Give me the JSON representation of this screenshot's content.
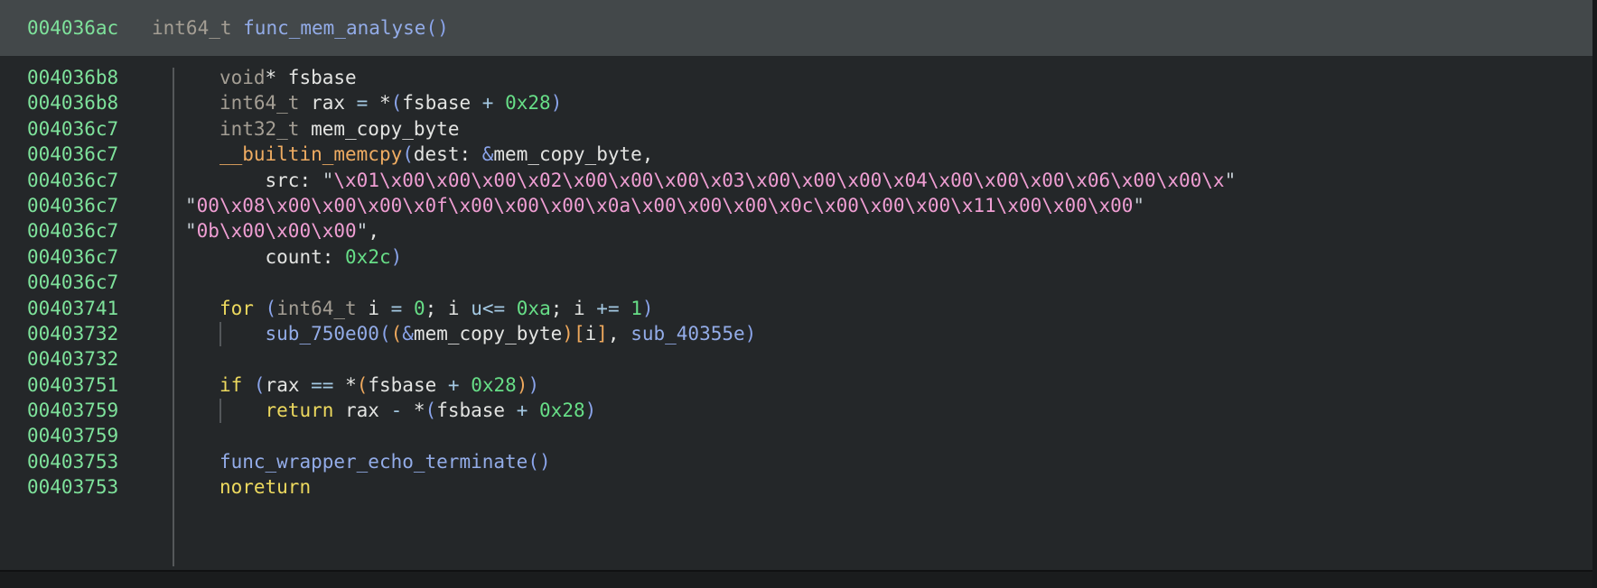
{
  "header": {
    "address": "004036ac",
    "return_type": "int64_t ",
    "function_name": "func_mem_analyse",
    "parens": "()"
  },
  "listing": {
    "lines": [
      {
        "address": "004036b8",
        "indent": 3,
        "guide": false,
        "segments": [
          {
            "c": "type",
            "t": "void"
          },
          {
            "c": "plain",
            "t": "* fsbase"
          }
        ]
      },
      {
        "address": "004036b8",
        "indent": 3,
        "guide": false,
        "segments": [
          {
            "c": "type",
            "t": "int64_t"
          },
          {
            "c": "plain",
            "t": " rax "
          },
          {
            "c": "op",
            "t": "="
          },
          {
            "c": "plain",
            "t": " *"
          },
          {
            "c": "p1",
            "t": "("
          },
          {
            "c": "plain",
            "t": "fsbase "
          },
          {
            "c": "op",
            "t": "+"
          },
          {
            "c": "plain",
            "t": " "
          },
          {
            "c": "num",
            "t": "0x28"
          },
          {
            "c": "p1",
            "t": ")"
          }
        ]
      },
      {
        "address": "004036c7",
        "indent": 3,
        "guide": false,
        "segments": [
          {
            "c": "type",
            "t": "int32_t"
          },
          {
            "c": "plain",
            "t": " mem_copy_byte"
          }
        ]
      },
      {
        "address": "004036c7",
        "indent": 3,
        "guide": false,
        "segments": [
          {
            "c": "builtin",
            "t": "__builtin_memcpy"
          },
          {
            "c": "p1",
            "t": "("
          },
          {
            "c": "plain",
            "t": "dest: "
          },
          {
            "c": "p1",
            "t": "&"
          },
          {
            "c": "plain",
            "t": "mem_copy_byte,"
          }
        ]
      },
      {
        "address": "004036c7",
        "indent": 7,
        "guide": false,
        "segments": [
          {
            "c": "plain",
            "t": "src: "
          },
          {
            "c": "q",
            "t": "\""
          },
          {
            "c": "str",
            "t": "\\x01\\x00\\x00\\x00\\x02\\x00\\x00\\x00\\x03\\x00\\x00\\x00\\x04\\x00\\x00\\x00\\x06\\x00\\x00\\x"
          },
          {
            "c": "q",
            "t": "\""
          }
        ]
      },
      {
        "address": "004036c7",
        "indent": 0,
        "guide": false,
        "segments": [
          {
            "c": "q",
            "t": "\""
          },
          {
            "c": "str",
            "t": "00\\x08\\x00\\x00\\x00\\x0f\\x00\\x00\\x00\\x0a\\x00\\x00\\x00\\x0c\\x00\\x00\\x00\\x11\\x00\\x00\\x00"
          },
          {
            "c": "q",
            "t": "\""
          }
        ]
      },
      {
        "address": "004036c7",
        "indent": 0,
        "guide": false,
        "segments": [
          {
            "c": "q",
            "t": "\""
          },
          {
            "c": "str",
            "t": "0b\\x00\\x00\\x00"
          },
          {
            "c": "q",
            "t": "\""
          },
          {
            "c": "plain",
            "t": ","
          }
        ]
      },
      {
        "address": "004036c7",
        "indent": 7,
        "guide": false,
        "segments": [
          {
            "c": "plain",
            "t": "count: "
          },
          {
            "c": "num",
            "t": "0x2c"
          },
          {
            "c": "p1",
            "t": ")"
          }
        ]
      },
      {
        "address": "004036c7",
        "indent": 0,
        "guide": false,
        "segments": []
      },
      {
        "address": "00403741",
        "indent": 3,
        "guide": false,
        "segments": [
          {
            "c": "kw",
            "t": "for"
          },
          {
            "c": "plain",
            "t": " "
          },
          {
            "c": "p1",
            "t": "("
          },
          {
            "c": "type",
            "t": "int64_t"
          },
          {
            "c": "plain",
            "t": " i "
          },
          {
            "c": "op",
            "t": "="
          },
          {
            "c": "plain",
            "t": " "
          },
          {
            "c": "num",
            "t": "0"
          },
          {
            "c": "plain",
            "t": "; i "
          },
          {
            "c": "op",
            "t": "u<="
          },
          {
            "c": "plain",
            "t": " "
          },
          {
            "c": "num",
            "t": "0xa"
          },
          {
            "c": "plain",
            "t": "; i "
          },
          {
            "c": "op",
            "t": "+="
          },
          {
            "c": "plain",
            "t": " "
          },
          {
            "c": "num",
            "t": "1"
          },
          {
            "c": "p1",
            "t": ")"
          }
        ]
      },
      {
        "address": "00403732",
        "indent": 7,
        "guide": true,
        "segments": [
          {
            "c": "fn",
            "t": "sub_750e00"
          },
          {
            "c": "p1",
            "t": "("
          },
          {
            "c": "p2",
            "t": "("
          },
          {
            "c": "p1",
            "t": "&"
          },
          {
            "c": "plain",
            "t": "mem_copy_byte"
          },
          {
            "c": "p2",
            "t": ")"
          },
          {
            "c": "p2",
            "t": "["
          },
          {
            "c": "plain",
            "t": "i"
          },
          {
            "c": "p2",
            "t": "]"
          },
          {
            "c": "plain",
            "t": ", "
          },
          {
            "c": "fn",
            "t": "sub_40355e"
          },
          {
            "c": "p1",
            "t": ")"
          }
        ]
      },
      {
        "address": "00403732",
        "indent": 0,
        "guide": false,
        "segments": []
      },
      {
        "address": "00403751",
        "indent": 3,
        "guide": false,
        "segments": [
          {
            "c": "kw",
            "t": "if"
          },
          {
            "c": "plain",
            "t": " "
          },
          {
            "c": "p1",
            "t": "("
          },
          {
            "c": "plain",
            "t": "rax "
          },
          {
            "c": "op",
            "t": "=="
          },
          {
            "c": "plain",
            "t": " *"
          },
          {
            "c": "p2",
            "t": "("
          },
          {
            "c": "plain",
            "t": "fsbase "
          },
          {
            "c": "op",
            "t": "+"
          },
          {
            "c": "plain",
            "t": " "
          },
          {
            "c": "num",
            "t": "0x28"
          },
          {
            "c": "p2",
            "t": ")"
          },
          {
            "c": "p1",
            "t": ")"
          }
        ]
      },
      {
        "address": "00403759",
        "indent": 7,
        "guide": true,
        "segments": [
          {
            "c": "kw",
            "t": "return"
          },
          {
            "c": "plain",
            "t": " rax "
          },
          {
            "c": "op",
            "t": "-"
          },
          {
            "c": "plain",
            "t": " *"
          },
          {
            "c": "p1",
            "t": "("
          },
          {
            "c": "plain",
            "t": "fsbase "
          },
          {
            "c": "op",
            "t": "+"
          },
          {
            "c": "plain",
            "t": " "
          },
          {
            "c": "num",
            "t": "0x28"
          },
          {
            "c": "p1",
            "t": ")"
          }
        ]
      },
      {
        "address": "00403759",
        "indent": 0,
        "guide": false,
        "segments": []
      },
      {
        "address": "00403753",
        "indent": 3,
        "guide": false,
        "segments": [
          {
            "c": "fn",
            "t": "func_wrapper_echo_terminate"
          },
          {
            "c": "p1",
            "t": "()"
          }
        ]
      },
      {
        "address": "00403753",
        "indent": 3,
        "guide": false,
        "segments": [
          {
            "c": "kw",
            "t": "noreturn"
          }
        ]
      }
    ]
  },
  "colors": {
    "bg": "#242729",
    "header-bg": "#43484a",
    "addr": "#7ee29b",
    "type": "#a49e94",
    "plain": "#e3e4e2",
    "fn": "#93ace8",
    "p1": "#8aa4ea",
    "p2": "#efa95d",
    "kw": "#edd95e",
    "num": "#67de87",
    "op": "#a4c9e3",
    "str": "#ef9ed3",
    "q": "#c5cdd3",
    "builtin": "#efac62",
    "separator": "#55585a",
    "guide": "#53575a",
    "bottom-bar": "#1a1c1d",
    "edge": "#17191b"
  }
}
